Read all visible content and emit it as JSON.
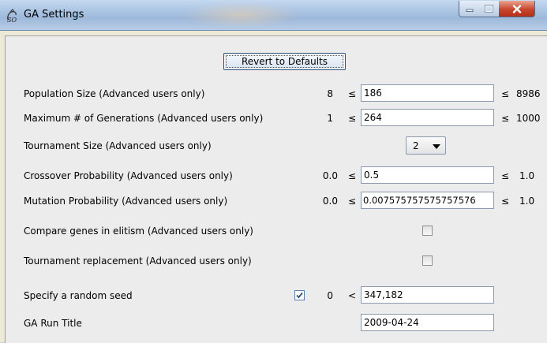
{
  "window": {
    "title": "GA Settings"
  },
  "revert_label": "Revert to Defaults",
  "leq": "≤",
  "lt": "<",
  "rows": {
    "population": {
      "label": "Population Size (Advanced users only)",
      "min": "8",
      "value": "186",
      "max": "8986"
    },
    "generations": {
      "label": "Maximum # of Generations (Advanced users only)",
      "min": "1",
      "value": "264",
      "max": "1000"
    },
    "tournament_size": {
      "label": "Tournament Size (Advanced users only)",
      "selected": "2"
    },
    "crossover": {
      "label": "Crossover Probability (Advanced users only)",
      "min": "0.0",
      "value": "0.5",
      "max": "1.0"
    },
    "mutation": {
      "label": "Mutation Probability (Advanced users only)",
      "min": "0.0",
      "value": "0.007575757575757576",
      "max": "1.0"
    },
    "elitism": {
      "label": "Compare genes in elitism (Advanced users only)",
      "checked": false
    },
    "replacement": {
      "label": "Tournament replacement (Advanced users only)",
      "checked": false
    },
    "seed": {
      "label": "Specify a random seed",
      "checked": true,
      "min": "0",
      "value": "347,182"
    },
    "run_title": {
      "label": "GA Run Title",
      "value": "2009-04-24"
    }
  }
}
